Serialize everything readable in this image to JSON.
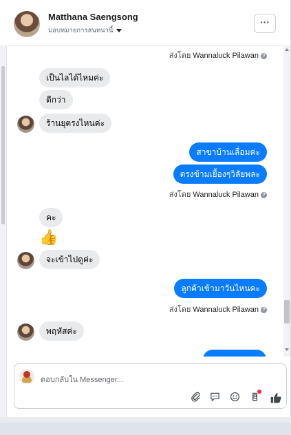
{
  "header": {
    "name": "Matthana Saengsong",
    "subtitle": "มอบหมายการสนทนานี้",
    "more_label": "···"
  },
  "thread": {
    "sent_by_prefix": "ส่งโดย",
    "sent_by_name": "Wannaluck Pilawan",
    "messages": [
      {
        "text": "เป็นไลได้ไหมค่ะ",
        "dir": "in"
      },
      {
        "text": "ดีกว่า",
        "dir": "in"
      },
      {
        "text": "ร้านยุตรงไหนค่ะ",
        "dir": "in"
      },
      {
        "text": "สาขาบ้านเลื่อมค่ะ",
        "dir": "out"
      },
      {
        "text": "ตรงข้ามเยื้องๆวิลัยพละ",
        "dir": "out"
      },
      {
        "text": "คะ",
        "dir": "in"
      },
      {
        "text": "👍",
        "dir": "in"
      },
      {
        "text": "จะเข้าไปดูค่ะ",
        "dir": "in"
      },
      {
        "text": "ลูกค้าเข้ามาวันไหนคะ",
        "dir": "out"
      },
      {
        "text": "พฤหัสค่ะ",
        "dir": "in"
      }
    ]
  },
  "composer": {
    "placeholder": "ตอบกลับใน Messenger..."
  },
  "colors": {
    "outgoing_bubble": "#0a7cff",
    "incoming_bubble": "#e9eaec",
    "notification_dot": "#f02849"
  },
  "icons": [
    "paperclip-icon",
    "message-icon",
    "emoji-icon",
    "sticker-icon",
    "thumbs-up-icon",
    "help-icon"
  ]
}
